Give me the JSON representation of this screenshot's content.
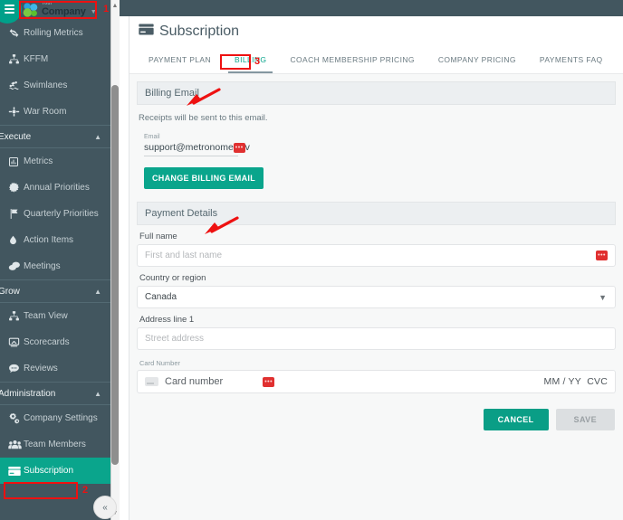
{
  "branding": {
    "logo_small_text": "Your",
    "logo_big_text": "Company",
    "caret_icon": "chevron-down-icon",
    "menu_icon": "hamburger-menu-icon",
    "accent_color": "#0aa58c",
    "sidebar_color": "#42565f",
    "annotation_color": "#ee1111"
  },
  "sidebar": {
    "top_items": [
      {
        "label": "Rolling Metrics",
        "icon": "refresh-cycle-icon"
      },
      {
        "label": "KFFM",
        "icon": "org-chart-icon"
      },
      {
        "label": "Swimlanes",
        "icon": "swimmer-icon"
      },
      {
        "label": "War Room",
        "icon": "crosshair-icon"
      }
    ],
    "sections": [
      {
        "title": "Execute",
        "chevron": "chevron-up-icon",
        "items": [
          {
            "label": "Metrics",
            "icon": "bar-chart-icon"
          },
          {
            "label": "Annual Priorities",
            "icon": "gear-burst-icon"
          },
          {
            "label": "Quarterly Priorities",
            "icon": "flag-icon"
          },
          {
            "label": "Action Items",
            "icon": "flame-drop-icon"
          },
          {
            "label": "Meetings",
            "icon": "chat-bubbles-icon"
          }
        ]
      },
      {
        "title": "Grow",
        "chevron": "chevron-up-icon",
        "items": [
          {
            "label": "Team View",
            "icon": "team-hierarchy-icon"
          },
          {
            "label": "Scorecards",
            "icon": "scorecard-icon"
          },
          {
            "label": "Reviews",
            "icon": "comment-dots-icon"
          }
        ]
      },
      {
        "title": "Administration",
        "chevron": "chevron-up-icon",
        "items": [
          {
            "label": "Company Settings",
            "icon": "gears-icon"
          },
          {
            "label": "Team Members",
            "icon": "users-icon"
          },
          {
            "label": "Subscription",
            "icon": "credit-card-icon",
            "active": true
          }
        ]
      }
    ],
    "collapse_button": "«"
  },
  "page": {
    "title": "Subscription",
    "title_icon": "credit-card-icon"
  },
  "tabs": [
    {
      "label": "PAYMENT PLAN",
      "active": false
    },
    {
      "label": "BILLING",
      "active": true
    },
    {
      "label": "COACH MEMBERSHIP PRICING",
      "active": false
    },
    {
      "label": "COMPANY PRICING",
      "active": false
    },
    {
      "label": "PAYMENTS FAQ",
      "active": false
    }
  ],
  "billing_email": {
    "section_title": "Billing Email",
    "description": "Receipts will be sent to this email.",
    "field_label": "Email",
    "value_prefix": "support@metronome",
    "value_suffix": "v",
    "redacted_marker": "•••",
    "change_button": "CHANGE BILLING EMAIL"
  },
  "payment_details": {
    "section_title": "Payment Details",
    "full_name_label": "Full name",
    "full_name_placeholder": "First and last name",
    "country_label": "Country or region",
    "country_value": "Canada",
    "country_chevron": "chevron-down-icon",
    "address_label": "Address line 1",
    "address_placeholder": "Street address",
    "card_label": "Card Number",
    "card_placeholder": "Card number",
    "card_expiry_placeholder": "MM / YY",
    "card_cvc_placeholder": "CVC",
    "redacted_marker": "•••",
    "cancel_button": "CANCEL",
    "save_button": "SAVE"
  },
  "annotations": [
    {
      "number": "1"
    },
    {
      "number": "2"
    },
    {
      "number": "3"
    }
  ]
}
